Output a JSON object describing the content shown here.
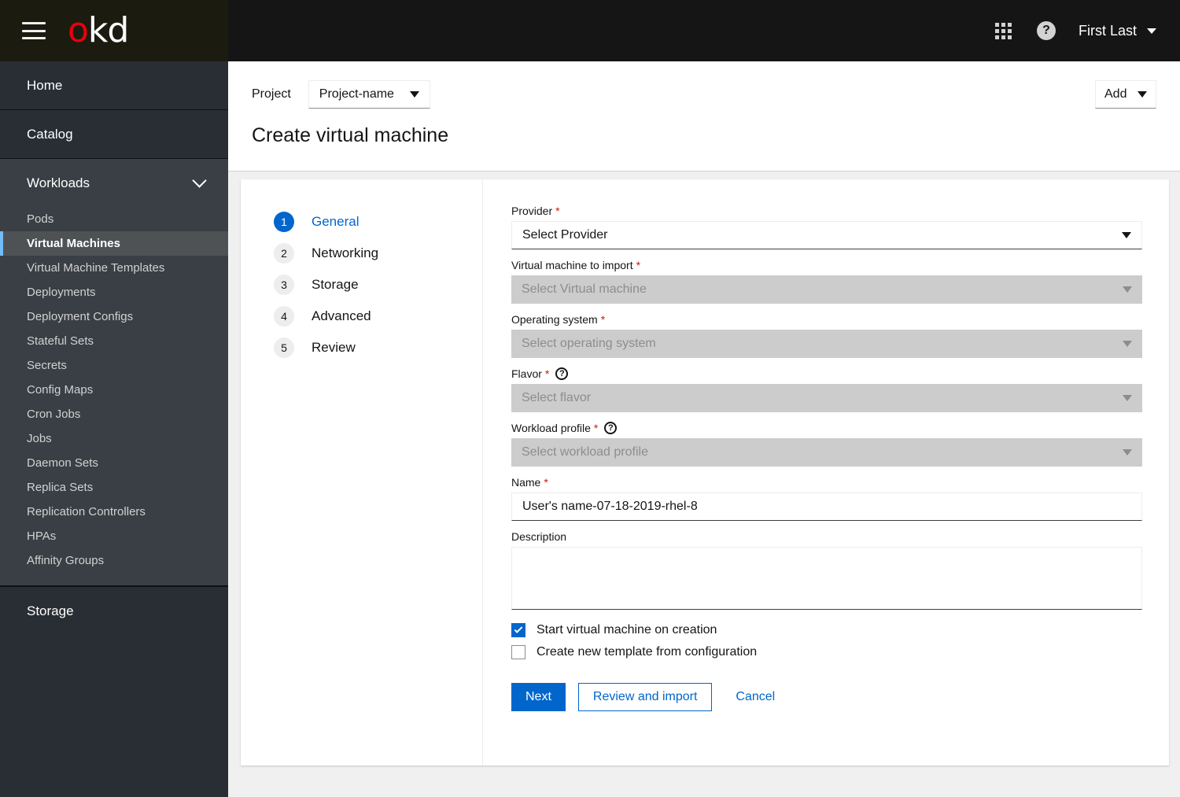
{
  "masthead": {
    "menu_icon": "hamburger-icon",
    "logo_o": "o",
    "logo_kd": "kd",
    "apps_icon": "grid-icon",
    "help_icon": "help-icon",
    "help_glyph": "?",
    "user_name": "First Last"
  },
  "sidebar": {
    "home": "Home",
    "catalog": "Catalog",
    "workloads": "Workloads",
    "workload_items": [
      {
        "label": "Pods",
        "active": false
      },
      {
        "label": "Virtual Machines",
        "active": true
      },
      {
        "label": "Virtual Machine Templates",
        "active": false
      },
      {
        "label": "Deployments",
        "active": false
      },
      {
        "label": "Deployment Configs",
        "active": false
      },
      {
        "label": "Stateful Sets",
        "active": false
      },
      {
        "label": "Secrets",
        "active": false
      },
      {
        "label": "Config Maps",
        "active": false
      },
      {
        "label": "Cron Jobs",
        "active": false
      },
      {
        "label": "Jobs",
        "active": false
      },
      {
        "label": "Daemon Sets",
        "active": false
      },
      {
        "label": "Replica Sets",
        "active": false
      },
      {
        "label": "Replication Controllers",
        "active": false
      },
      {
        "label": "HPAs",
        "active": false
      },
      {
        "label": "Affinity Groups",
        "active": false
      }
    ],
    "storage": "Storage"
  },
  "page_header": {
    "project_label": "Project",
    "project_value": "Project-name",
    "add_label": "Add",
    "title": "Create virtual machine"
  },
  "wizard": {
    "steps": [
      {
        "num": "1",
        "label": "General",
        "active": true
      },
      {
        "num": "2",
        "label": "Networking",
        "active": false
      },
      {
        "num": "3",
        "label": "Storage",
        "active": false
      },
      {
        "num": "4",
        "label": "Advanced",
        "active": false
      },
      {
        "num": "5",
        "label": "Review",
        "active": false
      }
    ]
  },
  "form": {
    "provider": {
      "label": "Provider",
      "required": true,
      "value": "Select Provider",
      "disabled": false
    },
    "vm_to_import": {
      "label": "Virtual machine to import",
      "required": true,
      "value": "Select Virtual machine",
      "disabled": true
    },
    "operating_system": {
      "label": "Operating system",
      "required": true,
      "value": "Select operating system",
      "disabled": true
    },
    "flavor": {
      "label": "Flavor",
      "required": true,
      "help": "?",
      "value": "Select flavor",
      "disabled": true
    },
    "workload_profile": {
      "label": "Workload profile",
      "required": true,
      "help": "?",
      "value": "Select workload profile",
      "disabled": true
    },
    "name": {
      "label": "Name",
      "required": true,
      "value": "User's name-07-18-2019-rhel-8",
      "placeholder": ""
    },
    "description": {
      "label": "Description",
      "value": "",
      "placeholder": ""
    },
    "start_vm": {
      "label": "Start virtual machine on creation",
      "checked": true
    },
    "create_template": {
      "label": "Create new template from configuration",
      "checked": false
    },
    "buttons": {
      "next": "Next",
      "review_and_import": "Review and import",
      "cancel": "Cancel"
    }
  },
  "colors": {
    "accent_blue": "#0066cc",
    "required_red": "#c9190b",
    "logo_red": "#e8000d",
    "active_nav_bar": "#73bcf7",
    "masthead_bg": "#151515",
    "sidebar_dark": "#292e34",
    "sidebar_light": "#393f44",
    "disabled_field": "#cccccc"
  }
}
